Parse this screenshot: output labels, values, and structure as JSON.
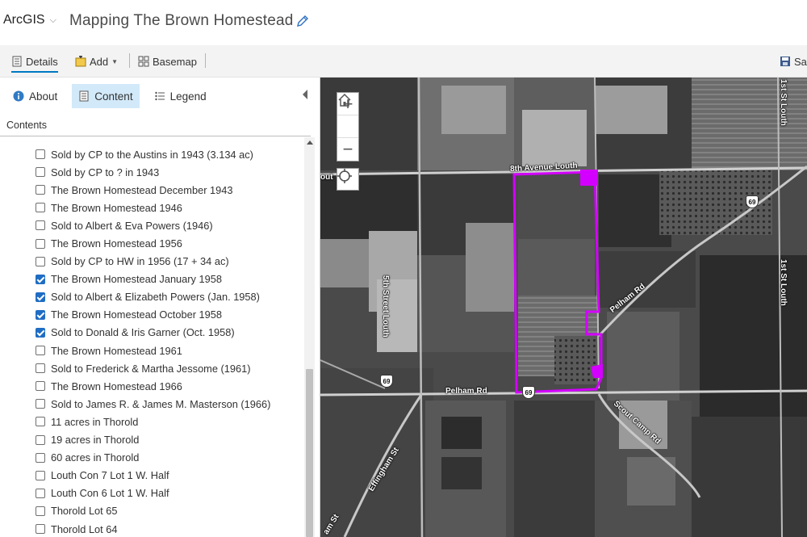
{
  "header": {
    "brand": "ArcGIS",
    "map_title": "Mapping The Brown Homestead"
  },
  "toolbar": {
    "details_label": "Details",
    "add_label": "Add",
    "basemap_label": "Basemap",
    "save_label": "Sav"
  },
  "panel": {
    "tabs": [
      {
        "label": "About"
      },
      {
        "label": "Content"
      },
      {
        "label": "Legend"
      }
    ],
    "contents_label": "Contents",
    "layers": [
      {
        "label": "Sold by CP to the Austins in 1943 (3.134 ac)",
        "checked": false
      },
      {
        "label": "Sold by CP to ? in 1943",
        "checked": false
      },
      {
        "label": "The Brown Homestead December 1943",
        "checked": false
      },
      {
        "label": "The Brown Homestead 1946",
        "checked": false
      },
      {
        "label": "Sold to Albert & Eva Powers (1946)",
        "checked": false
      },
      {
        "label": "The Brown Homestead 1956",
        "checked": false
      },
      {
        "label": "Sold by CP to HW in 1956 (17 + 34 ac)",
        "checked": false
      },
      {
        "label": "The Brown Homestead January 1958",
        "checked": true
      },
      {
        "label": "Sold to Albert & Elizabeth Powers (Jan. 1958)",
        "checked": true
      },
      {
        "label": "The Brown Homestead October 1958",
        "checked": true
      },
      {
        "label": "Sold to Donald & Iris Garner (Oct. 1958)",
        "checked": true
      },
      {
        "label": "The Brown Homestead 1961",
        "checked": false
      },
      {
        "label": "Sold to Frederick & Martha Jessome (1961)",
        "checked": false
      },
      {
        "label": "The Brown Homestead 1966",
        "checked": false
      },
      {
        "label": "Sold to James R. & James M. Masterson (1966)",
        "checked": false
      },
      {
        "label": "11 acres in Thorold",
        "checked": false
      },
      {
        "label": "19 acres in Thorold",
        "checked": false
      },
      {
        "label": "60 acres in Thorold",
        "checked": false
      },
      {
        "label": "Louth Con 7 Lot 1 W. Half",
        "checked": false
      },
      {
        "label": "Louth Con 6 Lot 1 W. Half",
        "checked": false
      },
      {
        "label": "Thorold Lot 65",
        "checked": false
      },
      {
        "label": "Thorold Lot 64",
        "checked": false
      }
    ]
  },
  "map": {
    "zoom_in": "+",
    "zoom_out": "−",
    "road_labels": {
      "eighth_ave": "8th Avenue Louth",
      "fifth_st": "5th Street Louth",
      "pelham_rd_h": "Pelham Rd",
      "pelham_rd_diag": "Pelham Rd",
      "scout_camp": "Scout Camp Rd",
      "effingham": "Effingham St",
      "first_st": "1st St Louth",
      "first_st_top": "1st St Louth",
      "louth_left": "out",
      "ham_st": "am St"
    },
    "shields": {
      "hwy_a": "69",
      "hwy_b": "69",
      "hwy_c": "69"
    },
    "parcel_color": "#d400ff"
  }
}
